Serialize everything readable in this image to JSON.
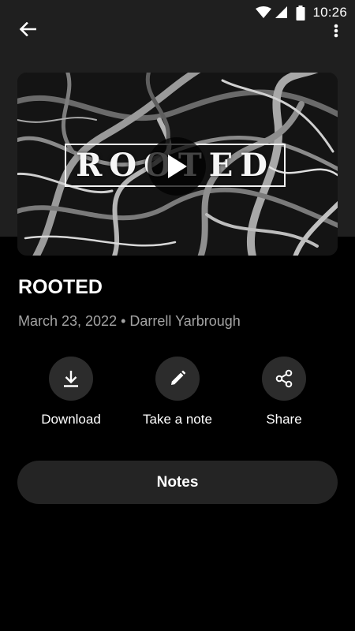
{
  "status_bar": {
    "time": "10:26",
    "icons": [
      "wifi-icon",
      "cell-signal-icon",
      "battery-icon"
    ]
  },
  "toolbar": {
    "back_icon": "arrow-left-icon",
    "menu_icon": "more-vert-icon"
  },
  "video": {
    "artwork_title": "ROOTED",
    "play_icon": "play-icon"
  },
  "sermon": {
    "title": "ROOTED",
    "meta": "March 23, 2022 • Darrell Yarbrough"
  },
  "actions": [
    {
      "label": "Download",
      "icon": "download-icon"
    },
    {
      "label": "Take a note",
      "icon": "pencil-icon"
    },
    {
      "label": "Share",
      "icon": "share-icon"
    }
  ],
  "notes_button": {
    "label": "Notes"
  },
  "colors": {
    "background": "#000000",
    "header_band": "#1f1f1f",
    "action_circle": "#2c2c2c",
    "notes_button": "#242424",
    "meta_text": "#a3a3a3"
  }
}
